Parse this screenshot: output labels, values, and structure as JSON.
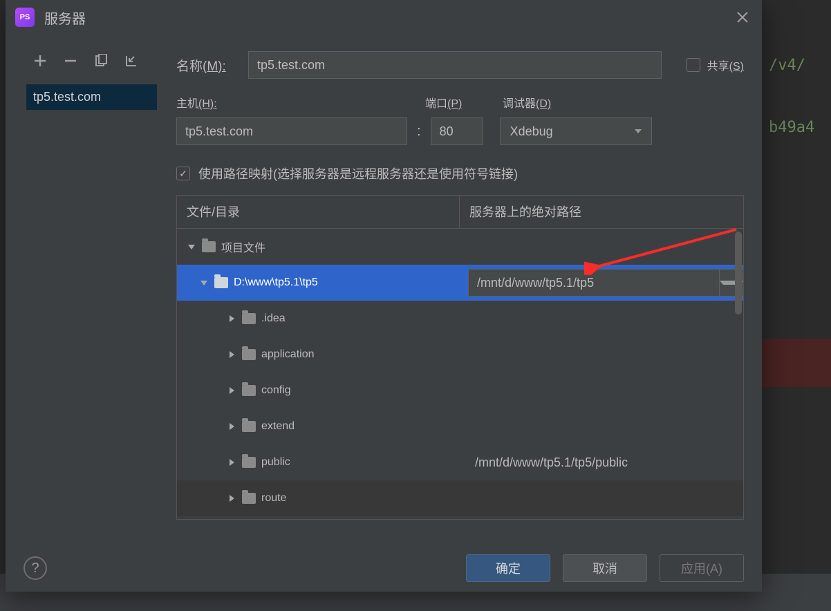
{
  "title": "服务器",
  "app_icon_text": "PS",
  "toolbar": {
    "add": "+",
    "remove": "−"
  },
  "servers": [
    {
      "name": "tp5.test.com"
    }
  ],
  "labels": {
    "name": "名称",
    "name_accel": "(M):",
    "host": "主机",
    "host_accel": "(H):",
    "port": "端口",
    "port_accel": "(P)",
    "debugger": "调试器",
    "debugger_accel": "(D)",
    "share": "共享",
    "share_accel": "(S)",
    "pathmap": "使用路径映射(选择服务器是远程服务器还是使用符号链接)",
    "file_dir": "文件/目录",
    "abs_path": "服务器上的绝对路径"
  },
  "form": {
    "name_value": "tp5.test.com",
    "host_value": "tp5.test.com",
    "port_value": "80",
    "debugger_value": "Xdebug",
    "share_checked": false,
    "pathmap_checked": true
  },
  "tree": {
    "root": "项目文件",
    "selected_local": "D:\\www\\tp5.1\\tp5",
    "selected_remote": "/mnt/d/www/tp5.1/tp5",
    "children": [
      {
        "name": ".idea",
        "remote": ""
      },
      {
        "name": "application",
        "remote": ""
      },
      {
        "name": "config",
        "remote": ""
      },
      {
        "name": "extend",
        "remote": ""
      },
      {
        "name": "public",
        "remote": "/mnt/d/www/tp5.1/tp5/public"
      },
      {
        "name": "route",
        "remote": ""
      }
    ]
  },
  "buttons": {
    "ok": "确定",
    "cancel": "取消",
    "apply": "应用(A)"
  },
  "bg_code": {
    "l1": "/v4/",
    "l2": "b49a4"
  }
}
